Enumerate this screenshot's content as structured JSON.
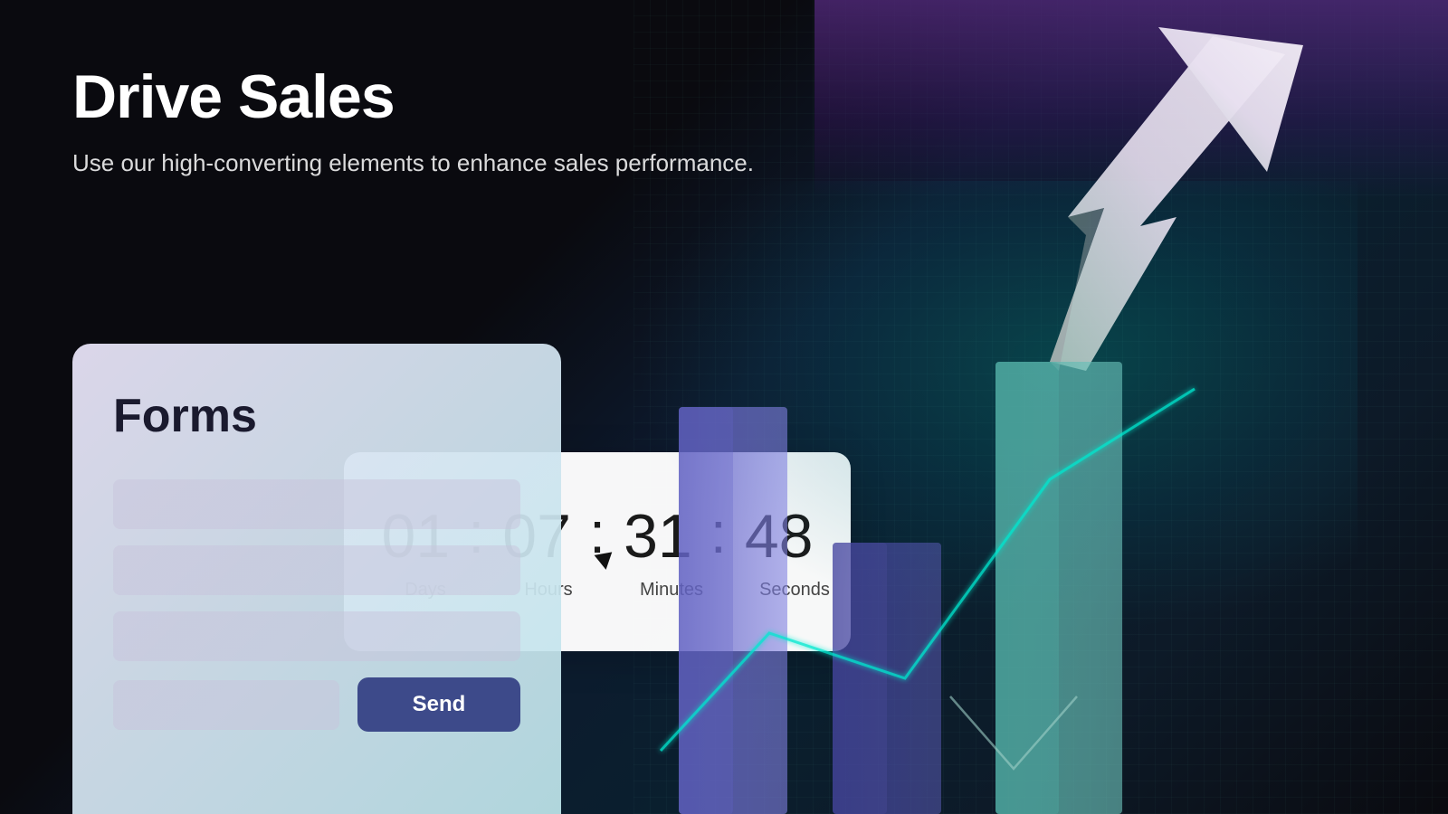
{
  "page": {
    "title": "Drive Sales",
    "subtitle": "Use our high-converting elements to enhance sales performance.",
    "background": {
      "primary": "#0a0a0f",
      "accent_teal": "#00b4a0",
      "accent_purple": "#50287a"
    }
  },
  "form_card": {
    "title": "Forms",
    "send_button_label": "Send"
  },
  "countdown": {
    "days_value": "01",
    "hours_value": "07",
    "minutes_value": "31",
    "seconds_value": "48",
    "days_label": "Days",
    "hours_label": "Hours",
    "minutes_label": "Minutes",
    "seconds_label": "Seconds",
    "colon": ":"
  }
}
